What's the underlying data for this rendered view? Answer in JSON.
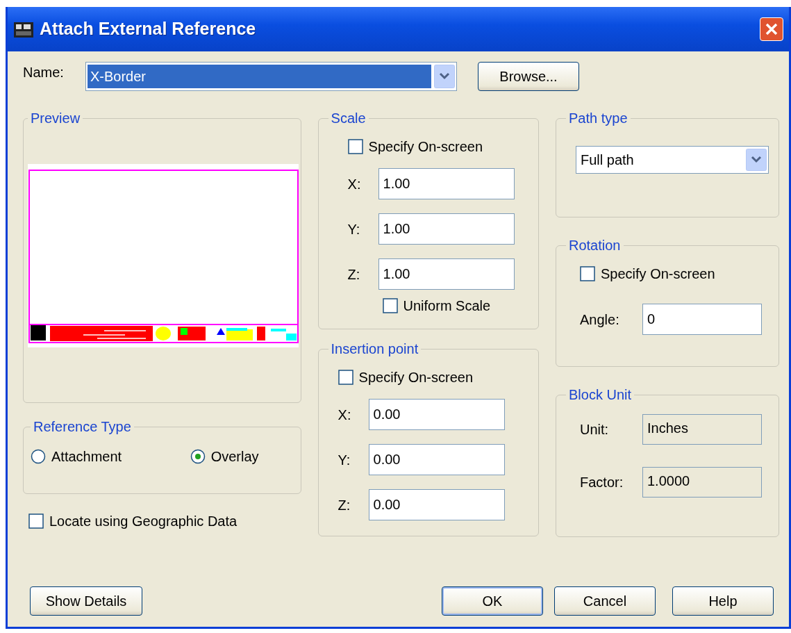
{
  "window": {
    "title": "Attach External Reference"
  },
  "name_field": {
    "label": "Name:",
    "value": "X-Border"
  },
  "browse_button": "Browse...",
  "preview": {
    "title": "Preview"
  },
  "reference_type": {
    "title": "Reference Type",
    "options": [
      {
        "label": "Attachment",
        "selected": false
      },
      {
        "label": "Overlay",
        "selected": true
      }
    ]
  },
  "locate_geographic": {
    "label": "Locate using Geographic Data",
    "checked": false
  },
  "scale": {
    "title": "Scale",
    "specify_onscreen": {
      "label": "Specify On-screen",
      "checked": false
    },
    "fields": [
      {
        "label": "X:",
        "value": "1.00"
      },
      {
        "label": "Y:",
        "value": "1.00"
      },
      {
        "label": "Z:",
        "value": "1.00"
      }
    ],
    "uniform_scale": {
      "label": "Uniform Scale",
      "checked": false
    }
  },
  "insertion_point": {
    "title": "Insertion point",
    "specify_onscreen": {
      "label": "Specify On-screen",
      "checked": false
    },
    "fields": [
      {
        "label": "X:",
        "value": "0.00"
      },
      {
        "label": "Y:",
        "value": "0.00"
      },
      {
        "label": "Z:",
        "value": "0.00"
      }
    ]
  },
  "path_type": {
    "title": "Path type",
    "value": "Full path"
  },
  "rotation": {
    "title": "Rotation",
    "specify_onscreen": {
      "label": "Specify On-screen",
      "checked": false
    },
    "angle": {
      "label": "Angle:",
      "value": "0"
    }
  },
  "block_unit": {
    "title": "Block Unit",
    "unit": {
      "label": "Unit:",
      "value": "Inches"
    },
    "factor": {
      "label": "Factor:",
      "value": "1.0000"
    }
  },
  "buttons": {
    "show_details": "Show Details",
    "ok": "OK",
    "cancel": "Cancel",
    "help": "Help"
  }
}
